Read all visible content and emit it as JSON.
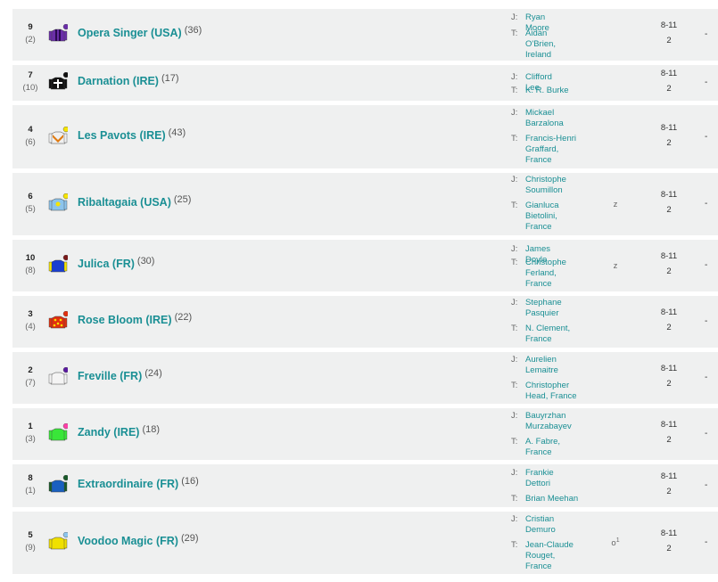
{
  "runners": [
    {
      "number": "9",
      "draw": "(2)",
      "name": "Opera Singer (USA)",
      "age": "(36)",
      "jockey_label": "J:",
      "jockey": "Ryan Moore",
      "trainer_label": "T:",
      "trainer": "Aidan O'Brien, Ireland",
      "headgear": "",
      "weight_st": "8-11",
      "weight_lb": "2",
      "dash": "-",
      "silk": {
        "body": "#6a2ea8",
        "cap": "#6a2ea8",
        "pattern": "stripes"
      }
    },
    {
      "number": "7",
      "draw": "(10)",
      "name": "Darnation (IRE)",
      "age": "(17)",
      "jockey_label": "J:",
      "jockey": "Clifford Lee",
      "trainer_label": "T:",
      "trainer": "K. R. Burke",
      "headgear": "",
      "weight_st": "8-11",
      "weight_lb": "2",
      "dash": "-",
      "silk": {
        "body": "#111111",
        "cap": "#111111",
        "pattern": "cross"
      }
    },
    {
      "number": "4",
      "draw": "(6)",
      "name": "Les Pavots (IRE)",
      "age": "(43)",
      "jockey_label": "J:",
      "jockey": "Mickael Barzalona",
      "trainer_label": "T:",
      "trainer": "Francis-Henri Graffard, France",
      "headgear": "",
      "weight_st": "8-11",
      "weight_lb": "2",
      "dash": "-",
      "silk": {
        "body": "#f0f0f0",
        "cap": "#f5e400",
        "pattern": "chevron"
      }
    },
    {
      "number": "6",
      "draw": "(5)",
      "name": "Ribaltagaia (USA)",
      "age": "(25)",
      "jockey_label": "J:",
      "jockey": "Christophe Soumillon",
      "trainer_label": "T:",
      "trainer": "Gianluca Bietolini, France",
      "headgear": "z",
      "weight_st": "8-11",
      "weight_lb": "2",
      "dash": "-",
      "silk": {
        "body": "#8cc4ec",
        "cap": "#f5e400",
        "pattern": "star"
      }
    },
    {
      "number": "10",
      "draw": "(8)",
      "name": "Julica (FR)",
      "age": "(30)",
      "jockey_label": "J:",
      "jockey": "James Doyle",
      "trainer_label": "T:",
      "trainer": "Christophe Ferland, France",
      "headgear": "z",
      "weight_st": "8-11",
      "weight_lb": "2",
      "dash": "-",
      "silk": {
        "body": "#1a3fd0",
        "cap": "#7a1a1a",
        "pattern": "sleeves"
      }
    },
    {
      "number": "3",
      "draw": "(4)",
      "name": "Rose Bloom (IRE)",
      "age": "(22)",
      "jockey_label": "J:",
      "jockey": "Stephane Pasquier",
      "trainer_label": "T:",
      "trainer": "N. Clement, France",
      "headgear": "",
      "weight_st": "8-11",
      "weight_lb": "2",
      "dash": "-",
      "silk": {
        "body": "#e03010",
        "cap": "#e03010",
        "pattern": "spots"
      }
    },
    {
      "number": "2",
      "draw": "(7)",
      "name": "Freville (FR)",
      "age": "(24)",
      "jockey_label": "J:",
      "jockey": "Aurelien Lemaitre",
      "trainer_label": "T:",
      "trainer": "Christopher Head, France",
      "headgear": "",
      "weight_st": "8-11",
      "weight_lb": "2",
      "dash": "-",
      "silk": {
        "body": "#f4f4f4",
        "cap": "#5a1aa0",
        "pattern": "plain"
      }
    },
    {
      "number": "1",
      "draw": "(3)",
      "name": "Zandy (IRE)",
      "age": "(18)",
      "jockey_label": "J:",
      "jockey": "Bauyrzhan Murzabayev",
      "trainer_label": "T:",
      "trainer": "A. Fabre, France",
      "headgear": "",
      "weight_st": "8-11",
      "weight_lb": "2",
      "dash": "-",
      "silk": {
        "body": "#39e639",
        "cap": "#ff3fa8",
        "pattern": "plain"
      }
    },
    {
      "number": "8",
      "draw": "(1)",
      "name": "Extraordinaire (FR)",
      "age": "(16)",
      "jockey_label": "J:",
      "jockey": "Frankie Dettori",
      "trainer_label": "T:",
      "trainer": "Brian Meehan",
      "headgear": "",
      "weight_st": "8-11",
      "weight_lb": "2",
      "dash": "-",
      "silk": {
        "body": "#1a60c0",
        "cap": "#1a5a2a",
        "pattern": "sleeves-dark"
      }
    },
    {
      "number": "5",
      "draw": "(9)",
      "name": "Voodoo Magic (FR)",
      "age": "(29)",
      "jockey_label": "J:",
      "jockey": "Cristian Demuro",
      "trainer_label": "T:",
      "trainer": "Jean-Claude Rouget, France",
      "headgear": "o",
      "headgear_sup": "1",
      "weight_st": "8-11",
      "weight_lb": "2",
      "dash": "-",
      "silk": {
        "body": "#f0e000",
        "cap": "#8cc4ec",
        "pattern": "plain"
      }
    }
  ]
}
